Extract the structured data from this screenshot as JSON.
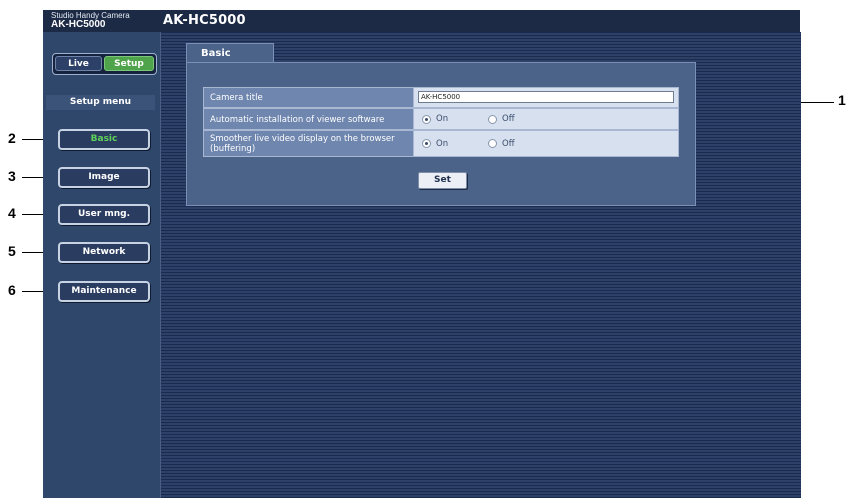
{
  "callouts": [
    "1",
    "2",
    "3",
    "4",
    "5",
    "6"
  ],
  "header": {
    "brand_subtitle": "Studio Handy Camera",
    "brand_model": "AK-HC5000",
    "title": "AK-HC5000"
  },
  "sidebar": {
    "live_label": "Live",
    "setup_label": "Setup",
    "section_label": "Setup menu",
    "items": [
      {
        "label": "Basic",
        "active": true
      },
      {
        "label": "Image",
        "active": false
      },
      {
        "label": "User mng.",
        "active": false
      },
      {
        "label": "Network",
        "active": false
      },
      {
        "label": "Maintenance",
        "active": false
      }
    ]
  },
  "main": {
    "tab_label": "Basic",
    "rows": [
      {
        "label": "Camera title",
        "value": "AK-HC5000"
      },
      {
        "label": "Automatic installation of viewer software",
        "options": [
          "On",
          "Off"
        ],
        "selected": "On"
      },
      {
        "label": "Smoother live video display on the browser (buffering)",
        "options": [
          "On",
          "Off"
        ],
        "selected": "On"
      }
    ],
    "set_label": "Set"
  },
  "colors": {
    "sidebar_bg": "#30476c",
    "active_item": "#5ed35a",
    "setup_active": "#4fa34a"
  }
}
